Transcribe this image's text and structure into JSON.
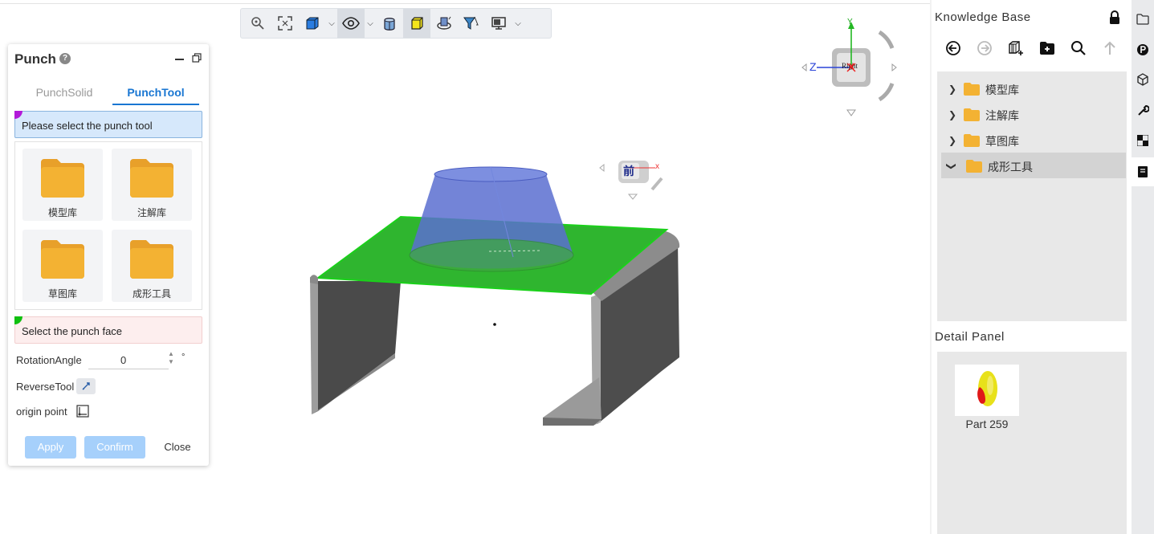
{
  "toolbar": {
    "buttons": [
      "zoom-icon",
      "fit-view-icon",
      "cube-view-icon",
      "eye-icon",
      "section-view-icon",
      "yellow-cube-icon",
      "rotate-part-icon",
      "filter-icon",
      "monitor-icon"
    ]
  },
  "punch_panel": {
    "title": "Punch",
    "help": "?",
    "tabs": [
      "PunchSolid",
      "PunchTool"
    ],
    "active_tab": "PunchTool",
    "select_tool_prompt": "Please select the punch tool",
    "select_face_prompt": "Select the punch face",
    "libraries": [
      {
        "label": "模型库"
      },
      {
        "label": "注解库"
      },
      {
        "label": "草图库"
      },
      {
        "label": "成形工具"
      }
    ],
    "rotation_label": "RotationAngle",
    "rotation_value": "0",
    "rotation_unit": "°",
    "reverse_label": "ReverseTool",
    "origin_label": "origin point",
    "apply": "Apply",
    "confirm": "Confirm",
    "close": "Close"
  },
  "view_cube": {
    "face_label": "Right",
    "axis_y": "Y",
    "axis_z": "Z",
    "axis_x": "X",
    "mini_face_label": "前",
    "mini_axis_x": "x"
  },
  "knowledge_base": {
    "title": "Knowledge Base",
    "tools": [
      "back-icon",
      "forward-icon",
      "add-library-icon",
      "new-folder-icon",
      "search-icon",
      "up-icon"
    ],
    "tree": [
      {
        "label": "模型库",
        "expanded": false
      },
      {
        "label": "注解库",
        "expanded": false
      },
      {
        "label": "草图库",
        "expanded": false
      },
      {
        "label": "成形工具",
        "expanded": true,
        "selected": true
      }
    ]
  },
  "detail_panel": {
    "title": "Detail Panel",
    "part_label": "Part 259"
  },
  "side_strip": [
    "folder-icon",
    "p-circle-icon",
    "cube-outline-icon",
    "wrench-icon",
    "checker-icon",
    "book-icon"
  ],
  "colors": {
    "accent": "#1976d2",
    "folder": "#f3b233",
    "face_green": "#1fb81f",
    "cone_blue": "#5b6fd0",
    "sheet_gray": "#555555"
  }
}
